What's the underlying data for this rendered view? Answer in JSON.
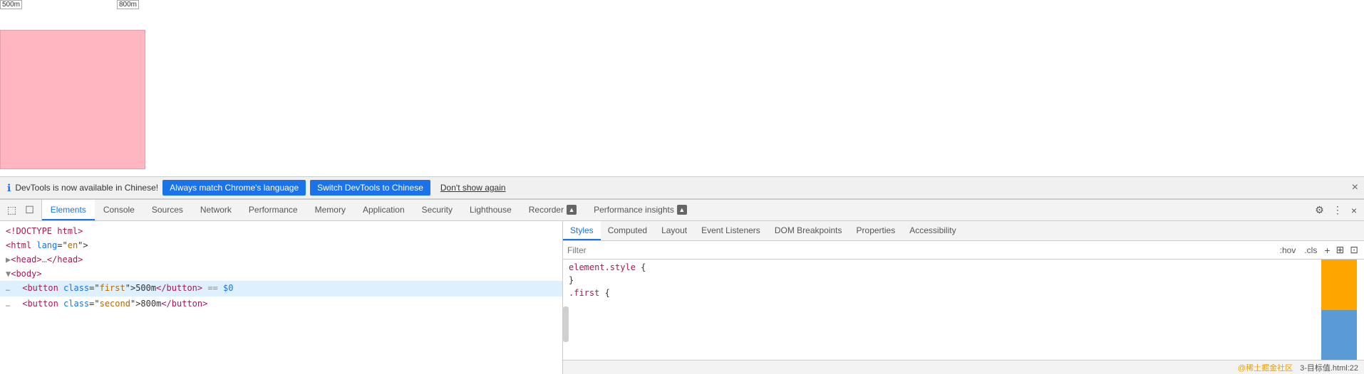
{
  "viewport": {
    "ruler_500": "500m",
    "ruler_800": "800m"
  },
  "notification": {
    "icon": "ℹ",
    "text": "DevTools is now available in Chinese!",
    "btn1_label": "Always match Chrome's language",
    "btn2_label": "Switch DevTools to Chinese",
    "btn3_label": "Don't show again",
    "close_label": "×"
  },
  "tabs": [
    {
      "label": "Elements",
      "active": true
    },
    {
      "label": "Console",
      "active": false
    },
    {
      "label": "Sources",
      "active": false
    },
    {
      "label": "Network",
      "active": false
    },
    {
      "label": "Performance",
      "active": false
    },
    {
      "label": "Memory",
      "active": false
    },
    {
      "label": "Application",
      "active": false
    },
    {
      "label": "Security",
      "active": false
    },
    {
      "label": "Lighthouse",
      "active": false
    },
    {
      "label": "Recorder",
      "active": false,
      "badge": "▲"
    },
    {
      "label": "Performance insights",
      "active": false,
      "badge": "▲"
    }
  ],
  "dom_lines": [
    {
      "content": "<!DOCTYPE html>",
      "type": "doctype"
    },
    {
      "content": "<html lang=\"en\">",
      "type": "tag"
    },
    {
      "content": "▶<head>…</head>",
      "type": "collapsed"
    },
    {
      "content": "▼<body>",
      "type": "open"
    },
    {
      "content": "  <button class=\"first\">500m</button>  == $0",
      "type": "highlighted"
    },
    {
      "content": "  <button class=\"second\">800m</button>",
      "type": "normal"
    }
  ],
  "styles_tabs": [
    {
      "label": "Styles",
      "active": true
    },
    {
      "label": "Computed",
      "active": false
    },
    {
      "label": "Layout",
      "active": false
    },
    {
      "label": "Event Listeners",
      "active": false
    },
    {
      "label": "DOM Breakpoints",
      "active": false
    },
    {
      "label": "Properties",
      "active": false
    },
    {
      "label": "Accessibility",
      "active": false
    }
  ],
  "styles_filter": {
    "placeholder": "Filter",
    "hov_label": ":hov",
    "cls_label": ".cls"
  },
  "styles_content": [
    {
      "selector": "element.style {",
      "props": []
    },
    {
      "selector": "}",
      "props": []
    },
    {
      "selector": ".first {",
      "props": []
    }
  ],
  "status_bar": {
    "location": "3-目标值.html:22",
    "watermark": "@稀土掘金社区"
  }
}
